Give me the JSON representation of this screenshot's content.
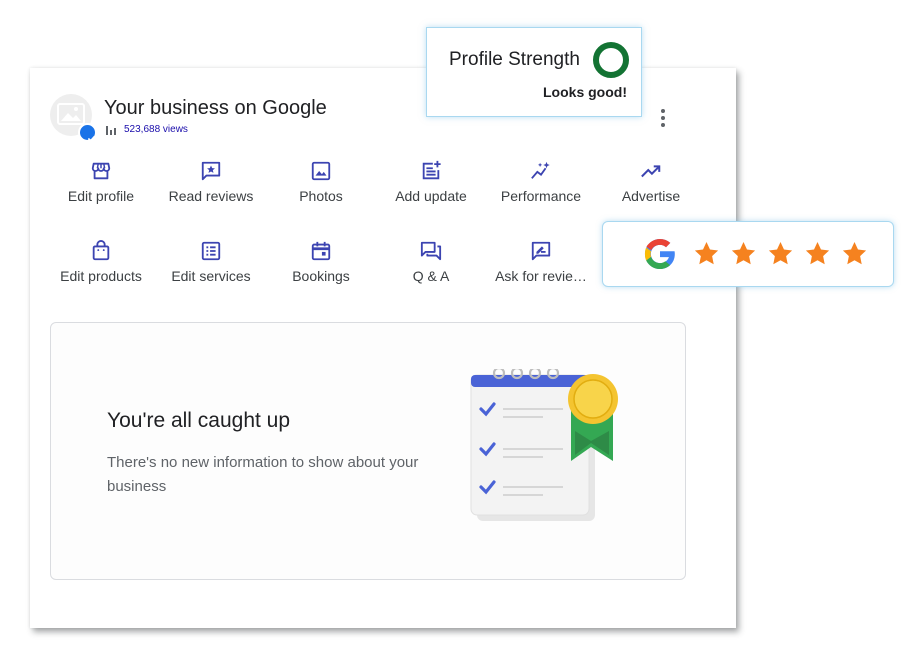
{
  "business": {
    "title": "Your business on Google",
    "views": "523,688 views"
  },
  "actions": [
    {
      "label": "Edit profile",
      "icon": "storefront-icon"
    },
    {
      "label": "Read reviews",
      "icon": "review-star-icon"
    },
    {
      "label": "Photos",
      "icon": "image-icon"
    },
    {
      "label": "Add update",
      "icon": "post-add-icon"
    },
    {
      "label": "Performance",
      "icon": "sparkle-trend-icon"
    },
    {
      "label": "Advertise",
      "icon": "trending-up-icon"
    },
    {
      "label": "Edit products",
      "icon": "shopping-bag-icon"
    },
    {
      "label": "Edit services",
      "icon": "list-icon"
    },
    {
      "label": "Bookings",
      "icon": "calendar-icon"
    },
    {
      "label": "Q & A",
      "icon": "forum-icon"
    },
    {
      "label": "Ask for revie…",
      "icon": "rate-review-icon"
    }
  ],
  "caught_up": {
    "title": "You're all caught up",
    "body": "There's no new information to show about your business"
  },
  "profile_strength": {
    "title": "Profile Strength",
    "status": "Looks good!"
  },
  "rating": {
    "stars": 5
  },
  "colors": {
    "accent": "#1a0dab",
    "icon_blue": "#3c44b1",
    "strength_green": "#137333",
    "star_orange": "#f5821f",
    "badge_blue": "#1a73e8"
  }
}
